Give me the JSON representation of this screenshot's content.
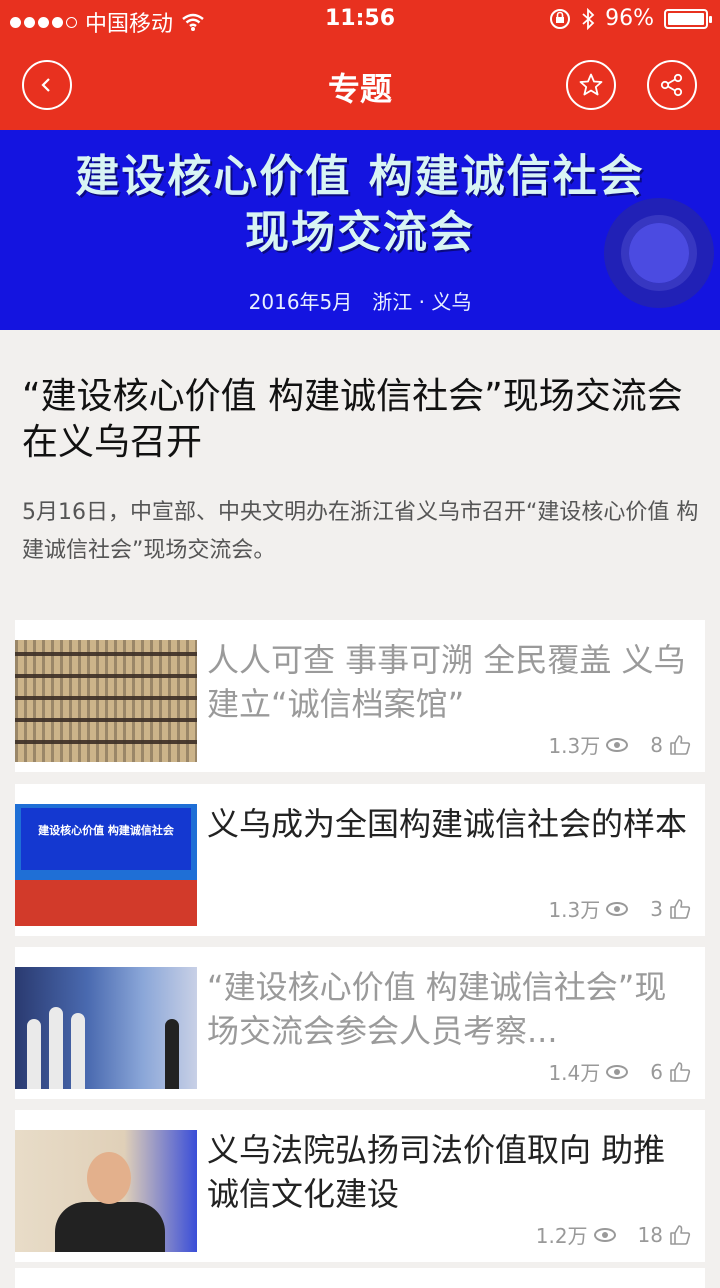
{
  "status": {
    "carrier": "中国移动",
    "time": "11:56",
    "battery": "96%"
  },
  "nav": {
    "title": "专题"
  },
  "banner": {
    "line1": "建设核心价值 构建诚信社会",
    "line2": "现场交流会",
    "line3": "2016年5月　浙江 · 义乌"
  },
  "article": {
    "headline": "“建设核心价值 构建诚信社会”现场交流会在义乌召开",
    "summary": "5月16日，中宣部、中央文明办在浙江省义乌市召开“建设核心价值 构建诚信社会”现场交流会。"
  },
  "cards": [
    {
      "title": "人人可查 事事可溯 全民覆盖 义乌建立“诚信档案馆”",
      "views": "1.3万",
      "likes": "8"
    },
    {
      "title": "义乌成为全国构建诚信社会的样本",
      "views": "1.3万",
      "likes": "3"
    },
    {
      "title": "“建设核心价值 构建诚信社会”现场交流会参会人员考察...",
      "views": "1.4万",
      "likes": "6"
    },
    {
      "title": "义乌法院弘扬司法价值取向 助推诚信文化建设",
      "views": "1.2万",
      "likes": "18"
    }
  ],
  "thumb2_text": "建设核心价值 构建诚信社会"
}
